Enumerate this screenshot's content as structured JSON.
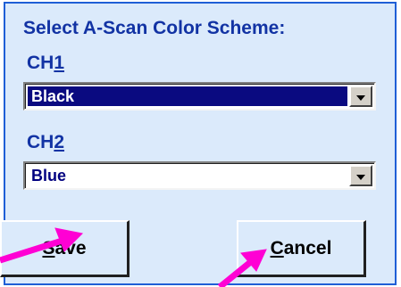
{
  "dialog": {
    "title": "Select A-Scan Color Scheme:",
    "ch1": {
      "prefix": "CH",
      "accel": "1",
      "selected_value": "Black"
    },
    "ch2": {
      "prefix": "CH",
      "accel": "2",
      "selected_value": "Blue"
    },
    "buttons": {
      "save": {
        "before": "",
        "accel": "S",
        "after": "ave"
      },
      "cancel": {
        "before": "",
        "accel": "C",
        "after": "ancel"
      }
    }
  },
  "colors": {
    "dialog_bg": "#dbeafb",
    "dialog_border": "#1f5fd6",
    "label_text": "#1233a4",
    "selection_bg": "#0a0a80",
    "annotation_arrow": "#ff00d4"
  },
  "icons": [
    "dropdown-arrow-icon",
    "annotation-arrow"
  ]
}
